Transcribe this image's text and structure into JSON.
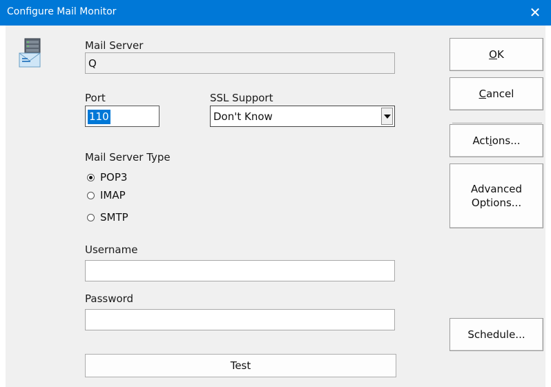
{
  "window": {
    "title": "Configure Mail Monitor",
    "close_glyph": "✕"
  },
  "icon": {
    "name": "mail-server-icon"
  },
  "mail_server": {
    "label": "Mail Server",
    "value": "Q"
  },
  "port": {
    "label": "Port",
    "value": "110"
  },
  "ssl": {
    "label": "SSL Support",
    "value": "Don't Know"
  },
  "server_type": {
    "label": "Mail Server Type",
    "options": [
      {
        "label": "POP3",
        "selected": true
      },
      {
        "label": "IMAP",
        "selected": false
      },
      {
        "label": "SMTP",
        "selected": false
      }
    ]
  },
  "username": {
    "label": "Username",
    "value": ""
  },
  "password": {
    "label": "Password",
    "value": ""
  },
  "buttons": {
    "ok": "OK",
    "ok_mnemonic": "O",
    "cancel": "Cancel",
    "cancel_mnemonic": "C",
    "actions_pre": "Act",
    "actions_mnemonic": "i",
    "actions_post": "ons...",
    "advanced_line1": "Advanced",
    "advanced_line2": "Options...",
    "schedule": "Schedule...",
    "test": "Test"
  },
  "colors": {
    "titlebar": "#0078d7",
    "dialog_bg": "#f0f0f0",
    "selection": "#0078d7"
  }
}
